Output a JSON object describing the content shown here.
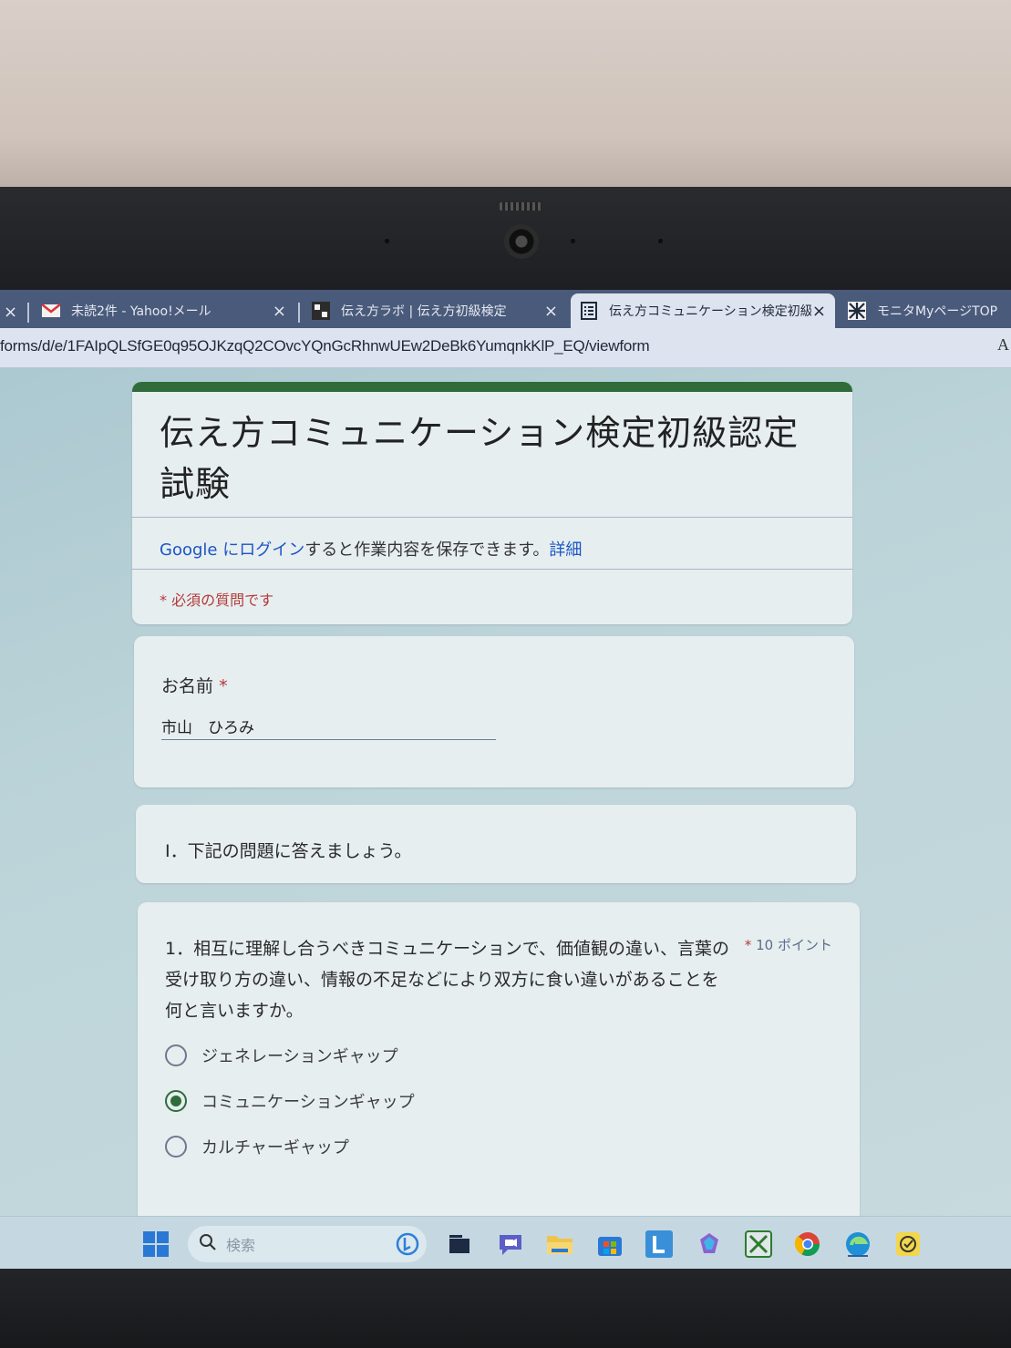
{
  "browser": {
    "tabs": [
      {
        "label": "未読2件 - Yahoo!メール",
        "icon": "yahoo-mail-icon"
      },
      {
        "label": "伝え方ラボ | 伝え方初級検定",
        "icon": "tsutaekata-lab-icon"
      },
      {
        "label": "伝え方コミュニケーション検定初級認定",
        "icon": "google-forms-icon",
        "active": true
      },
      {
        "label": "モニタMyページTOP",
        "icon": "monitor-site-icon"
      }
    ],
    "close_glyph": "×",
    "url": "forms/d/e/1FAIpQLSfGE0q95OJKzqQ2COvcYQnGcRhnwUEw2DeBk6YumqnkKlP_EQ/viewform",
    "reader_label": "A"
  },
  "form": {
    "title": "伝え方コミュニケーション検定初級認定試験",
    "login_google": "Google",
    "login_link": " にログイン",
    "login_rest": "すると作業内容を保存できます。",
    "login_details": "詳細",
    "required_note": "* 必須の質問です",
    "name_question": {
      "label": "お名前",
      "star": "*",
      "value": "市山　ひろみ"
    },
    "section_title": "Ⅰ．下記の問題に答えましょう。",
    "question1": {
      "text": "1．相互に理解し合うべきコミュニケーションで、価値観の違い、言葉の受け取り方の違い、情報の不足などにより双方に食い違いがあることを何と言いますか。",
      "points_star": "*",
      "points": "10 ポイント",
      "options": [
        {
          "label": "ジェネレーションギャップ",
          "selected": false
        },
        {
          "label": "コミュニケーションギャップ",
          "selected": true
        },
        {
          "label": "カルチャーギャップ",
          "selected": false
        }
      ]
    }
  },
  "taskbar": {
    "search_placeholder": "検索",
    "icons": [
      "windows-start-icon",
      "bing-icon",
      "task-view-icon",
      "chat-icon",
      "file-explorer-icon",
      "store-icon",
      "app-l-icon",
      "copilot-icon",
      "xbox-icon",
      "chrome-icon",
      "edge-icon",
      "todo-icon"
    ]
  },
  "colors": {
    "accent": "#2f6c3a",
    "link": "#1a56c4",
    "required": "#b33a3a"
  }
}
